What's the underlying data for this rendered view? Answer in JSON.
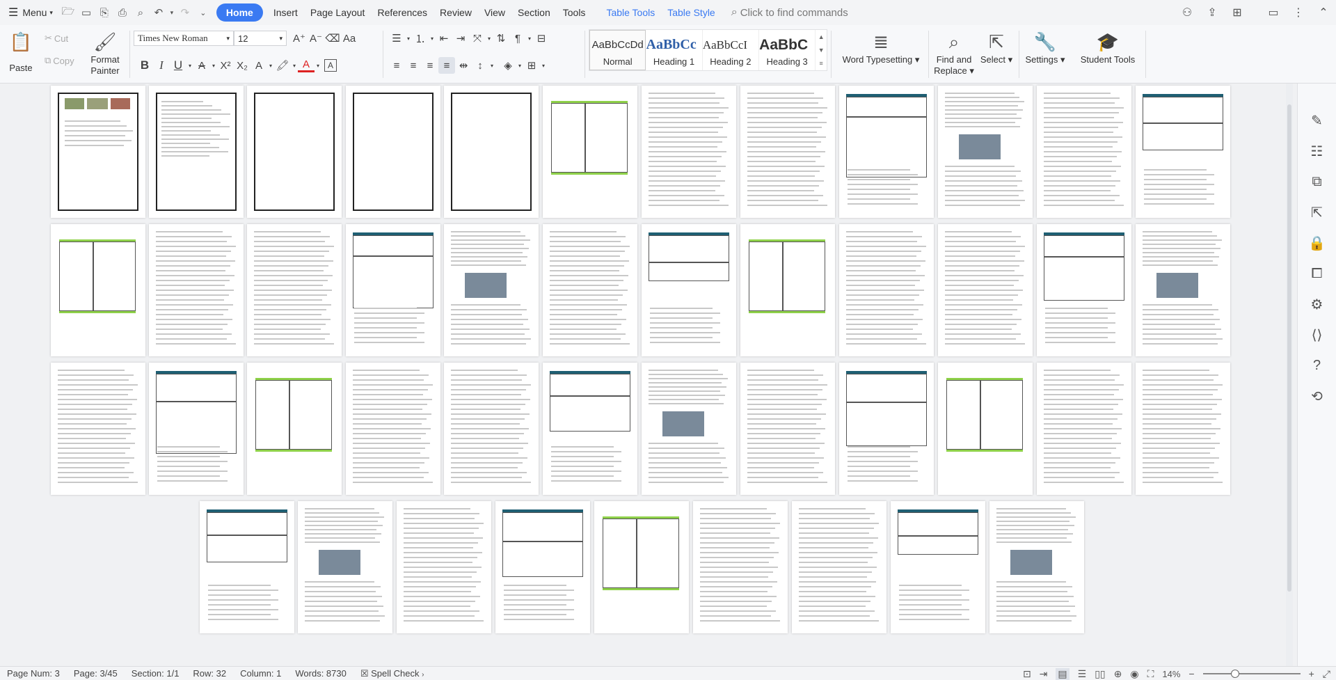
{
  "menubar": {
    "menu_label": "Menu",
    "tabs": [
      "Home",
      "Insert",
      "Page Layout",
      "References",
      "Review",
      "View",
      "Section",
      "Tools"
    ],
    "context_tabs": [
      "Table Tools",
      "Table Style"
    ],
    "find_placeholder": "Click to find commands"
  },
  "ribbon": {
    "paste": "Paste",
    "cut": "Cut",
    "copy": "Copy",
    "format_painter_1": "Format",
    "format_painter_2": "Painter",
    "font_name": "Times New Roman",
    "font_size": "12",
    "styles": [
      {
        "preview": "AaBbCcDd",
        "name": "Normal"
      },
      {
        "preview": "AaBbCc",
        "name": "Heading 1"
      },
      {
        "preview": "AaBbCcI",
        "name": "Heading 2"
      },
      {
        "preview": "AaBbC",
        "name": "Heading 3"
      }
    ],
    "word_typesetting": "Word Typesetting",
    "find_replace_1": "Find and",
    "find_replace_2": "Replace",
    "select": "Select",
    "settings": "Settings",
    "student_tools": "Student Tools"
  },
  "statusbar": {
    "page_num": "Page Num: 3",
    "page": "Page: 3/45",
    "section": "Section: 1/1",
    "row": "Row: 32",
    "column": "Column: 1",
    "words": "Words: 8730",
    "spell_check": "Spell Check",
    "zoom": "14%"
  },
  "colors": {
    "accent": "#3a7af2",
    "table_header": "#1f5f73",
    "table_green": "#8fd14a"
  }
}
